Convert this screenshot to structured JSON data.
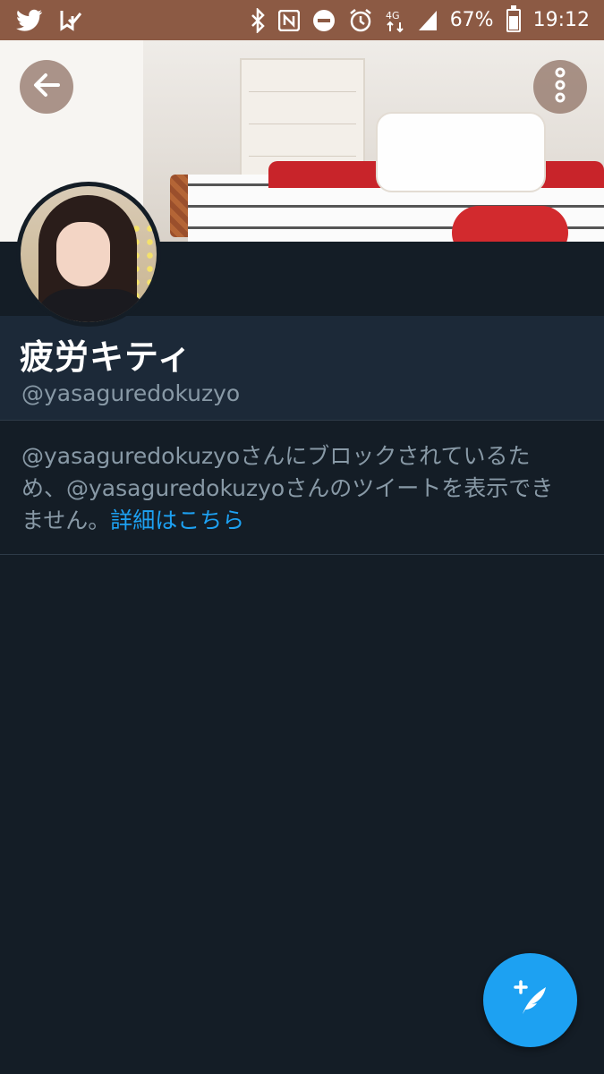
{
  "status_bar": {
    "battery": "67%",
    "time": "19:12",
    "battery_level": 0.67,
    "icons": [
      "twitter-icon",
      "check-list-icon",
      "bluetooth-icon",
      "nfc-icon",
      "do-not-disturb-icon",
      "alarm-icon",
      "data-arrows-icon",
      "signal-icon",
      "battery-icon"
    ]
  },
  "header": {
    "back_icon": "arrow-left-icon",
    "more_icon": "more-vertical-icon"
  },
  "profile": {
    "display_name": "疲労キティ",
    "handle": "@yasaguredokuzyo"
  },
  "blocked_notice": {
    "text": "@yasaguredokuzyoさんにブロックされているため、@yasaguredokuzyoさんのツイートを表示できません。",
    "link_text": "詳細はこちら"
  },
  "compose": {
    "icon": "compose-tweet-icon"
  },
  "colors": {
    "status_bar_bg": "#8c5a44",
    "page_bg": "#141d26",
    "panel_bg": "#1c2938",
    "secondary_text": "#8899a6",
    "accent": "#1da1f2"
  }
}
